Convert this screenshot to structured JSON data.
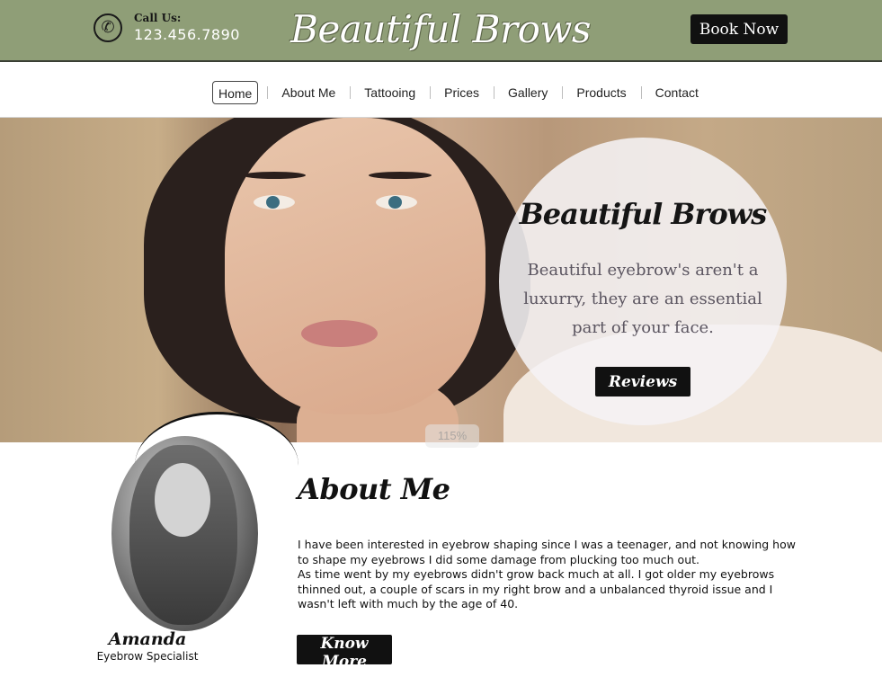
{
  "header": {
    "call_label": "Call Us:",
    "phone_number": "123.456.7890",
    "phone_icon": "phone-icon",
    "brand": "Beautiful Brows",
    "book_label": "Book Now",
    "background_color": "#8f9e77"
  },
  "nav": {
    "items": [
      {
        "label": "Home",
        "active": true
      },
      {
        "label": "About Me"
      },
      {
        "label": "Tattooing"
      },
      {
        "label": "Prices"
      },
      {
        "label": "Gallery"
      },
      {
        "label": "Products"
      },
      {
        "label": "Contact"
      }
    ]
  },
  "hero": {
    "title": "Beautiful Brows",
    "tagline": "Beautiful eyebrow's aren't a luxurry, they are an essential part of your face.",
    "reviews_label": "Reviews",
    "zoom": "115%"
  },
  "about": {
    "title": "About Me",
    "person_name": "Amanda",
    "person_role": "Eyebrow Specialist",
    "paragraph_1": "I have been interested in eyebrow shaping since I was a teenager, and not knowing how to shape my eyebrows I did some damage from plucking too much out.",
    "paragraph_2": "As time went by my eyebrows didn't grow back much at all. I got older my eyebrows thinned out, a couple of scars in my right brow and a unbalanced thyroid issue and I wasn't left with much by the age of 40.",
    "know_more_label": "Know More"
  }
}
